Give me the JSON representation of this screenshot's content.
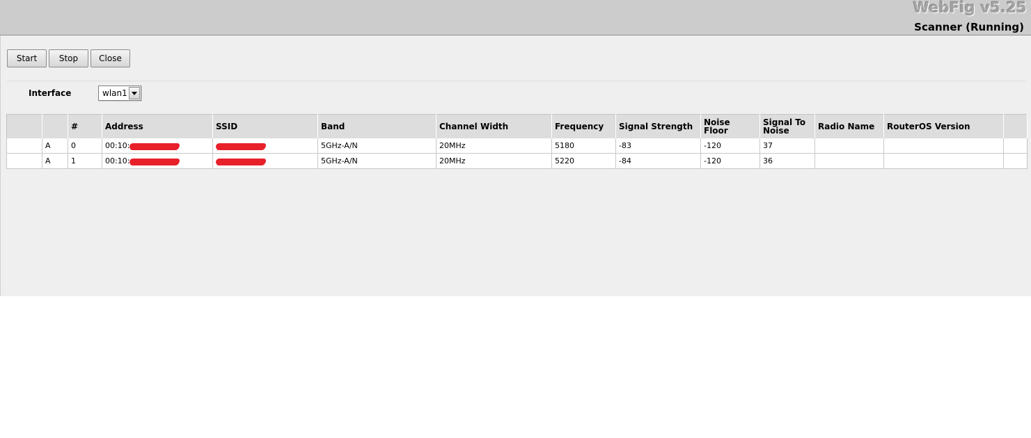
{
  "header": {
    "brand": "WebFig v5.25",
    "window_title": "Scanner (Running)"
  },
  "toolbar": {
    "start_label": "Start",
    "stop_label": "Stop",
    "close_label": "Close"
  },
  "interface": {
    "label": "Interface",
    "value": "wlan1"
  },
  "table": {
    "columns": [
      "",
      "",
      "#",
      "Address",
      "SSID",
      "Band",
      "Channel Width",
      "Frequency",
      "Signal Strength",
      "Noise Floor",
      "Signal To Noise",
      "Radio Name",
      "RouterOS Version",
      ""
    ],
    "rows": [
      {
        "flag": "A",
        "num": "0",
        "address_prefix": "00:10:",
        "band": "5GHz-A/N",
        "channel_width": "20MHz",
        "frequency": "5180",
        "signal_strength": "-83",
        "noise_floor": "-120",
        "snr": "37",
        "radio_name": "",
        "routeros_version": ""
      },
      {
        "flag": "A",
        "num": "1",
        "address_prefix": "00:10:",
        "band": "5GHz-A/N",
        "channel_width": "20MHz",
        "frequency": "5220",
        "signal_strength": "-84",
        "noise_floor": "-120",
        "snr": "36",
        "radio_name": "",
        "routeros_version": ""
      }
    ]
  },
  "colors": {
    "header_bg": "#cccccc",
    "content_bg": "#efefef",
    "redaction": "#e8202a"
  }
}
